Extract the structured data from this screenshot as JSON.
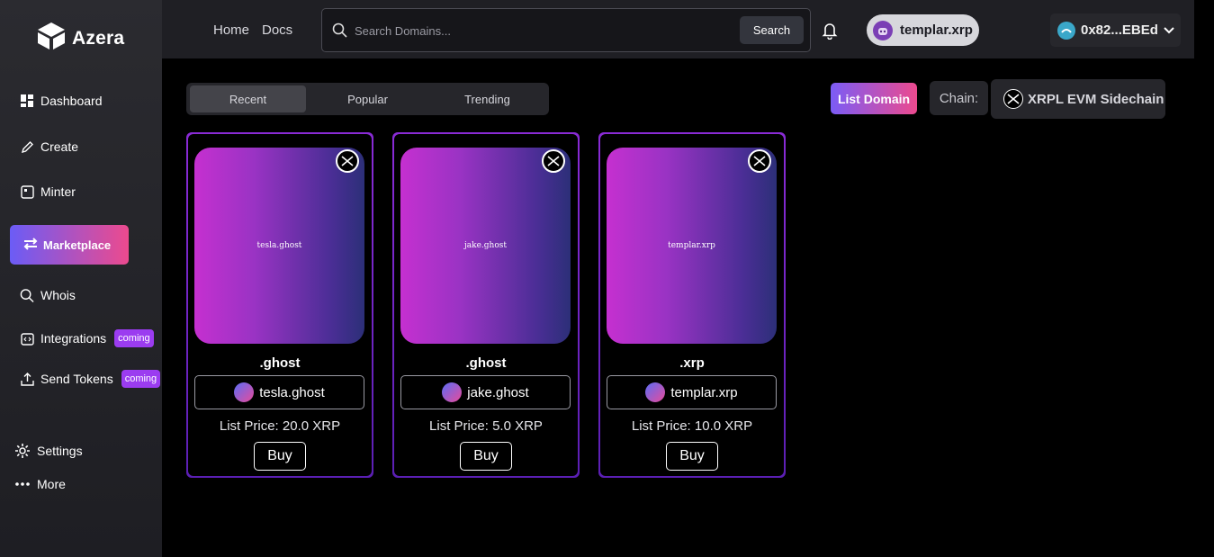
{
  "brand": {
    "name": "Azera"
  },
  "sidebar": {
    "items": [
      {
        "label": "Dashboard",
        "icon": "dashboard-icon"
      },
      {
        "label": "Create",
        "icon": "pencil-icon"
      },
      {
        "label": "Minter",
        "icon": "minter-icon"
      },
      {
        "label": "Marketplace",
        "icon": "swap-icon"
      },
      {
        "label": "Whois",
        "icon": "search-icon"
      },
      {
        "label": "Integrations",
        "icon": "code-icon",
        "badge": "coming"
      },
      {
        "label": "Send Tokens",
        "icon": "upload-icon",
        "badge": "coming"
      },
      {
        "label": "Settings",
        "icon": "gear-icon"
      },
      {
        "label": "More",
        "icon": "more-icon"
      }
    ]
  },
  "header": {
    "links": [
      "Home",
      "Docs"
    ],
    "search_placeholder": "Search Domains...",
    "search_button": "Search",
    "user": "templar.xrp",
    "wallet": "0x82...EBEd"
  },
  "tabs": [
    "Recent",
    "Popular",
    "Trending"
  ],
  "actions": {
    "list_domain": "List Domain",
    "chain_label": "Chain:",
    "chain": "XRPL EVM Sidechain"
  },
  "cards": [
    {
      "image_text": "tesla.ghost",
      "tld": ".ghost",
      "name": "tesla.ghost",
      "price": "List Price: 20.0 XRP",
      "buy": "Buy"
    },
    {
      "image_text": "jake.ghost",
      "tld": ".ghost",
      "name": "jake.ghost",
      "price": "List Price: 5.0 XRP",
      "buy": "Buy"
    },
    {
      "image_text": "templar.xrp",
      "tld": ".xrp",
      "name": "templar.xrp",
      "price": "List Price: 10.0 XRP",
      "buy": "Buy"
    }
  ],
  "colors": {
    "accent_start": "#6b5cf6",
    "accent_end": "#ec4a8e",
    "badge": "#9b3cf0",
    "card_border": "#8a2bd6"
  }
}
